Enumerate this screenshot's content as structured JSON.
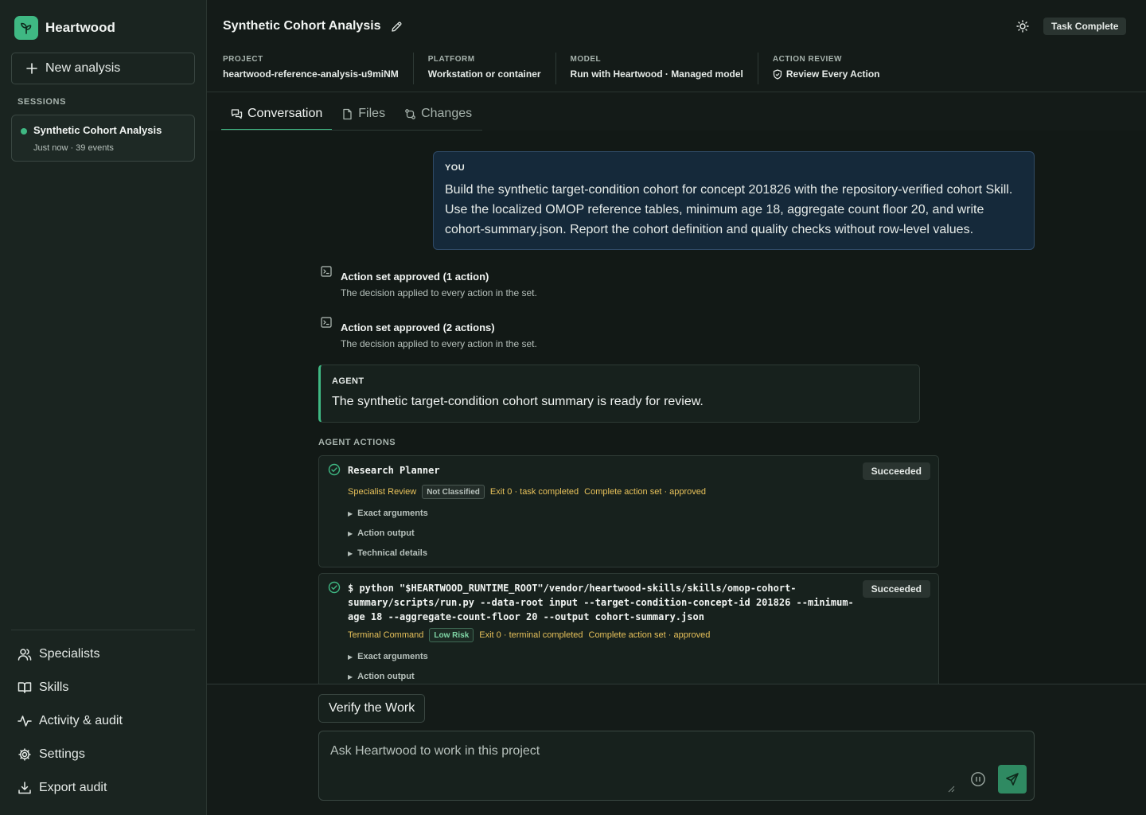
{
  "app": {
    "name": "Heartwood"
  },
  "sidebar": {
    "new_analysis": "New analysis",
    "sessions_label": "SESSIONS",
    "session": {
      "title": "Synthetic Cohort Analysis",
      "meta": "Just now · 39 events"
    },
    "nav": [
      {
        "label": "Specialists",
        "icon": "user-icon"
      },
      {
        "label": "Skills",
        "icon": "book-icon"
      },
      {
        "label": "Activity & audit",
        "icon": "activity-icon"
      },
      {
        "label": "Settings",
        "icon": "gear-icon"
      },
      {
        "label": "Export audit",
        "icon": "download-icon"
      }
    ]
  },
  "header": {
    "title": "Synthetic Cohort Analysis",
    "status": "Task Complete",
    "meta": [
      {
        "label": "PROJECT",
        "value": "heartwood-reference-analysis-u9miNM"
      },
      {
        "label": "PLATFORM",
        "value": "Workstation or container"
      },
      {
        "label": "MODEL",
        "value": "Run with Heartwood · Managed model"
      },
      {
        "label": "ACTION REVIEW",
        "value": "Review Every Action"
      }
    ]
  },
  "tabs": [
    {
      "label": "Conversation",
      "active": true
    },
    {
      "label": "Files",
      "active": false
    },
    {
      "label": "Changes",
      "active": false
    }
  ],
  "conversation": {
    "you_label": "YOU",
    "you_text": "Build the synthetic target-condition cohort for concept 201826 with the repository-verified cohort Skill. Use the localized OMOP reference tables, minimum age 18, aggregate count floor 20, and write cohort-summary.json. Report the cohort definition and quality checks without row-level values.",
    "events": [
      {
        "title": "Action set approved (1 action)",
        "desc": "The decision applied to every action in the set."
      },
      {
        "title": "Action set approved (2 actions)",
        "desc": "The decision applied to every action in the set."
      }
    ],
    "agent_label": "AGENT",
    "agent_text": "The synthetic target-condition cohort summary is ready for review.",
    "actions_label": "AGENT ACTIONS",
    "actions": [
      {
        "name": "Research Planner",
        "status": "Succeeded",
        "kind": "Specialist Review",
        "badge": "Not Classified",
        "exit": "Exit 0 · task completed",
        "set": "Complete action set · approved",
        "disclosures": [
          "Exact arguments",
          "Action output",
          "Technical details"
        ]
      },
      {
        "name": "$ python \"$HEARTWOOD_RUNTIME_ROOT\"/vendor/heartwood-skills/skills/omop-cohort-summary/scripts/run.py --data-root input --target-condition-concept-id 201826 --minimum-age 18 --aggregate-count-floor 20 --output cohort-summary.json",
        "status": "Succeeded",
        "kind": "Terminal Command",
        "badge": "Low Risk",
        "exit": "Exit 0 · terminal completed",
        "set": "Complete action set · approved",
        "disclosures": [
          "Exact arguments",
          "Action output"
        ]
      }
    ]
  },
  "composer": {
    "suggestion": "Verify the Work",
    "placeholder": "Ask Heartwood to work in this project"
  },
  "colors": {
    "accent": "#3fb883",
    "warning_text": "#e7c15a",
    "background": "#141b18"
  }
}
